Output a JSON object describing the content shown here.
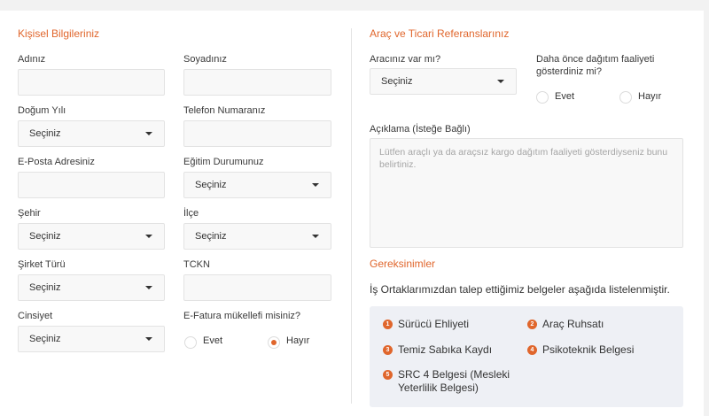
{
  "left": {
    "title": "Kişisel Bilgileriniz",
    "ad_label": "Adınız",
    "soyad_label": "Soyadınız",
    "dogum_label": "Doğum Yılı",
    "dogum_value": "Seçiniz",
    "telefon_label": "Telefon Numaranız",
    "eposta_label": "E-Posta Adresiniz",
    "egitim_label": "Eğitim Durumunuz",
    "egitim_value": "Seçiniz",
    "sehir_label": "Şehir",
    "sehir_value": "Seçiniz",
    "ilce_label": "İlçe",
    "ilce_value": "Seçiniz",
    "sirket_label": "Şirket Türü",
    "sirket_value": "Seçiniz",
    "tckn_label": "TCKN",
    "cinsiyet_label": "Cinsiyet",
    "cinsiyet_value": "Seçiniz",
    "efatura_label": "E-Fatura mükellefi misiniz?",
    "efatura_evet": "Evet",
    "efatura_hayir": "Hayır",
    "efatura_selected": "Hayır"
  },
  "right": {
    "title": "Araç ve Ticari Referanslarınız",
    "arac_label": "Aracınız var mı?",
    "arac_value": "Seçiniz",
    "dagitim_label_line1": "Daha önce dağıtım faaliyeti",
    "dagitim_label_line2": "gösterdiniz mi?",
    "dagitim_evet": "Evet",
    "dagitim_hayir": "Hayır",
    "aciklama_label": "Açıklama (İsteğe Bağlı)",
    "aciklama_placeholder": "Lütfen araçlı ya da araçsız kargo dağıtım faaliyeti gösterdiyseniz bunu belirtiniz."
  },
  "requirements": {
    "title": "Gereksinimler",
    "intro": "İş Ortaklarımızdan talep ettiğimiz belgeler aşağıda listelenmiştir.",
    "items": [
      {
        "num": "1",
        "text": "Sürücü Ehliyeti"
      },
      {
        "num": "2",
        "text": "Araç Ruhsatı"
      },
      {
        "num": "3",
        "text": "Temiz Sabıka Kaydı"
      },
      {
        "num": "4",
        "text": "Psikoteknik Belgesi"
      },
      {
        "num": "5",
        "text_line1": "SRC 4 Belgesi (Mesleki",
        "text_line2": "Yeterlilik Belgesi)"
      }
    ]
  },
  "colors": {
    "accent": "#e0662c",
    "field_bg": "#f8f8f8",
    "req_bg": "#eef0f5"
  }
}
